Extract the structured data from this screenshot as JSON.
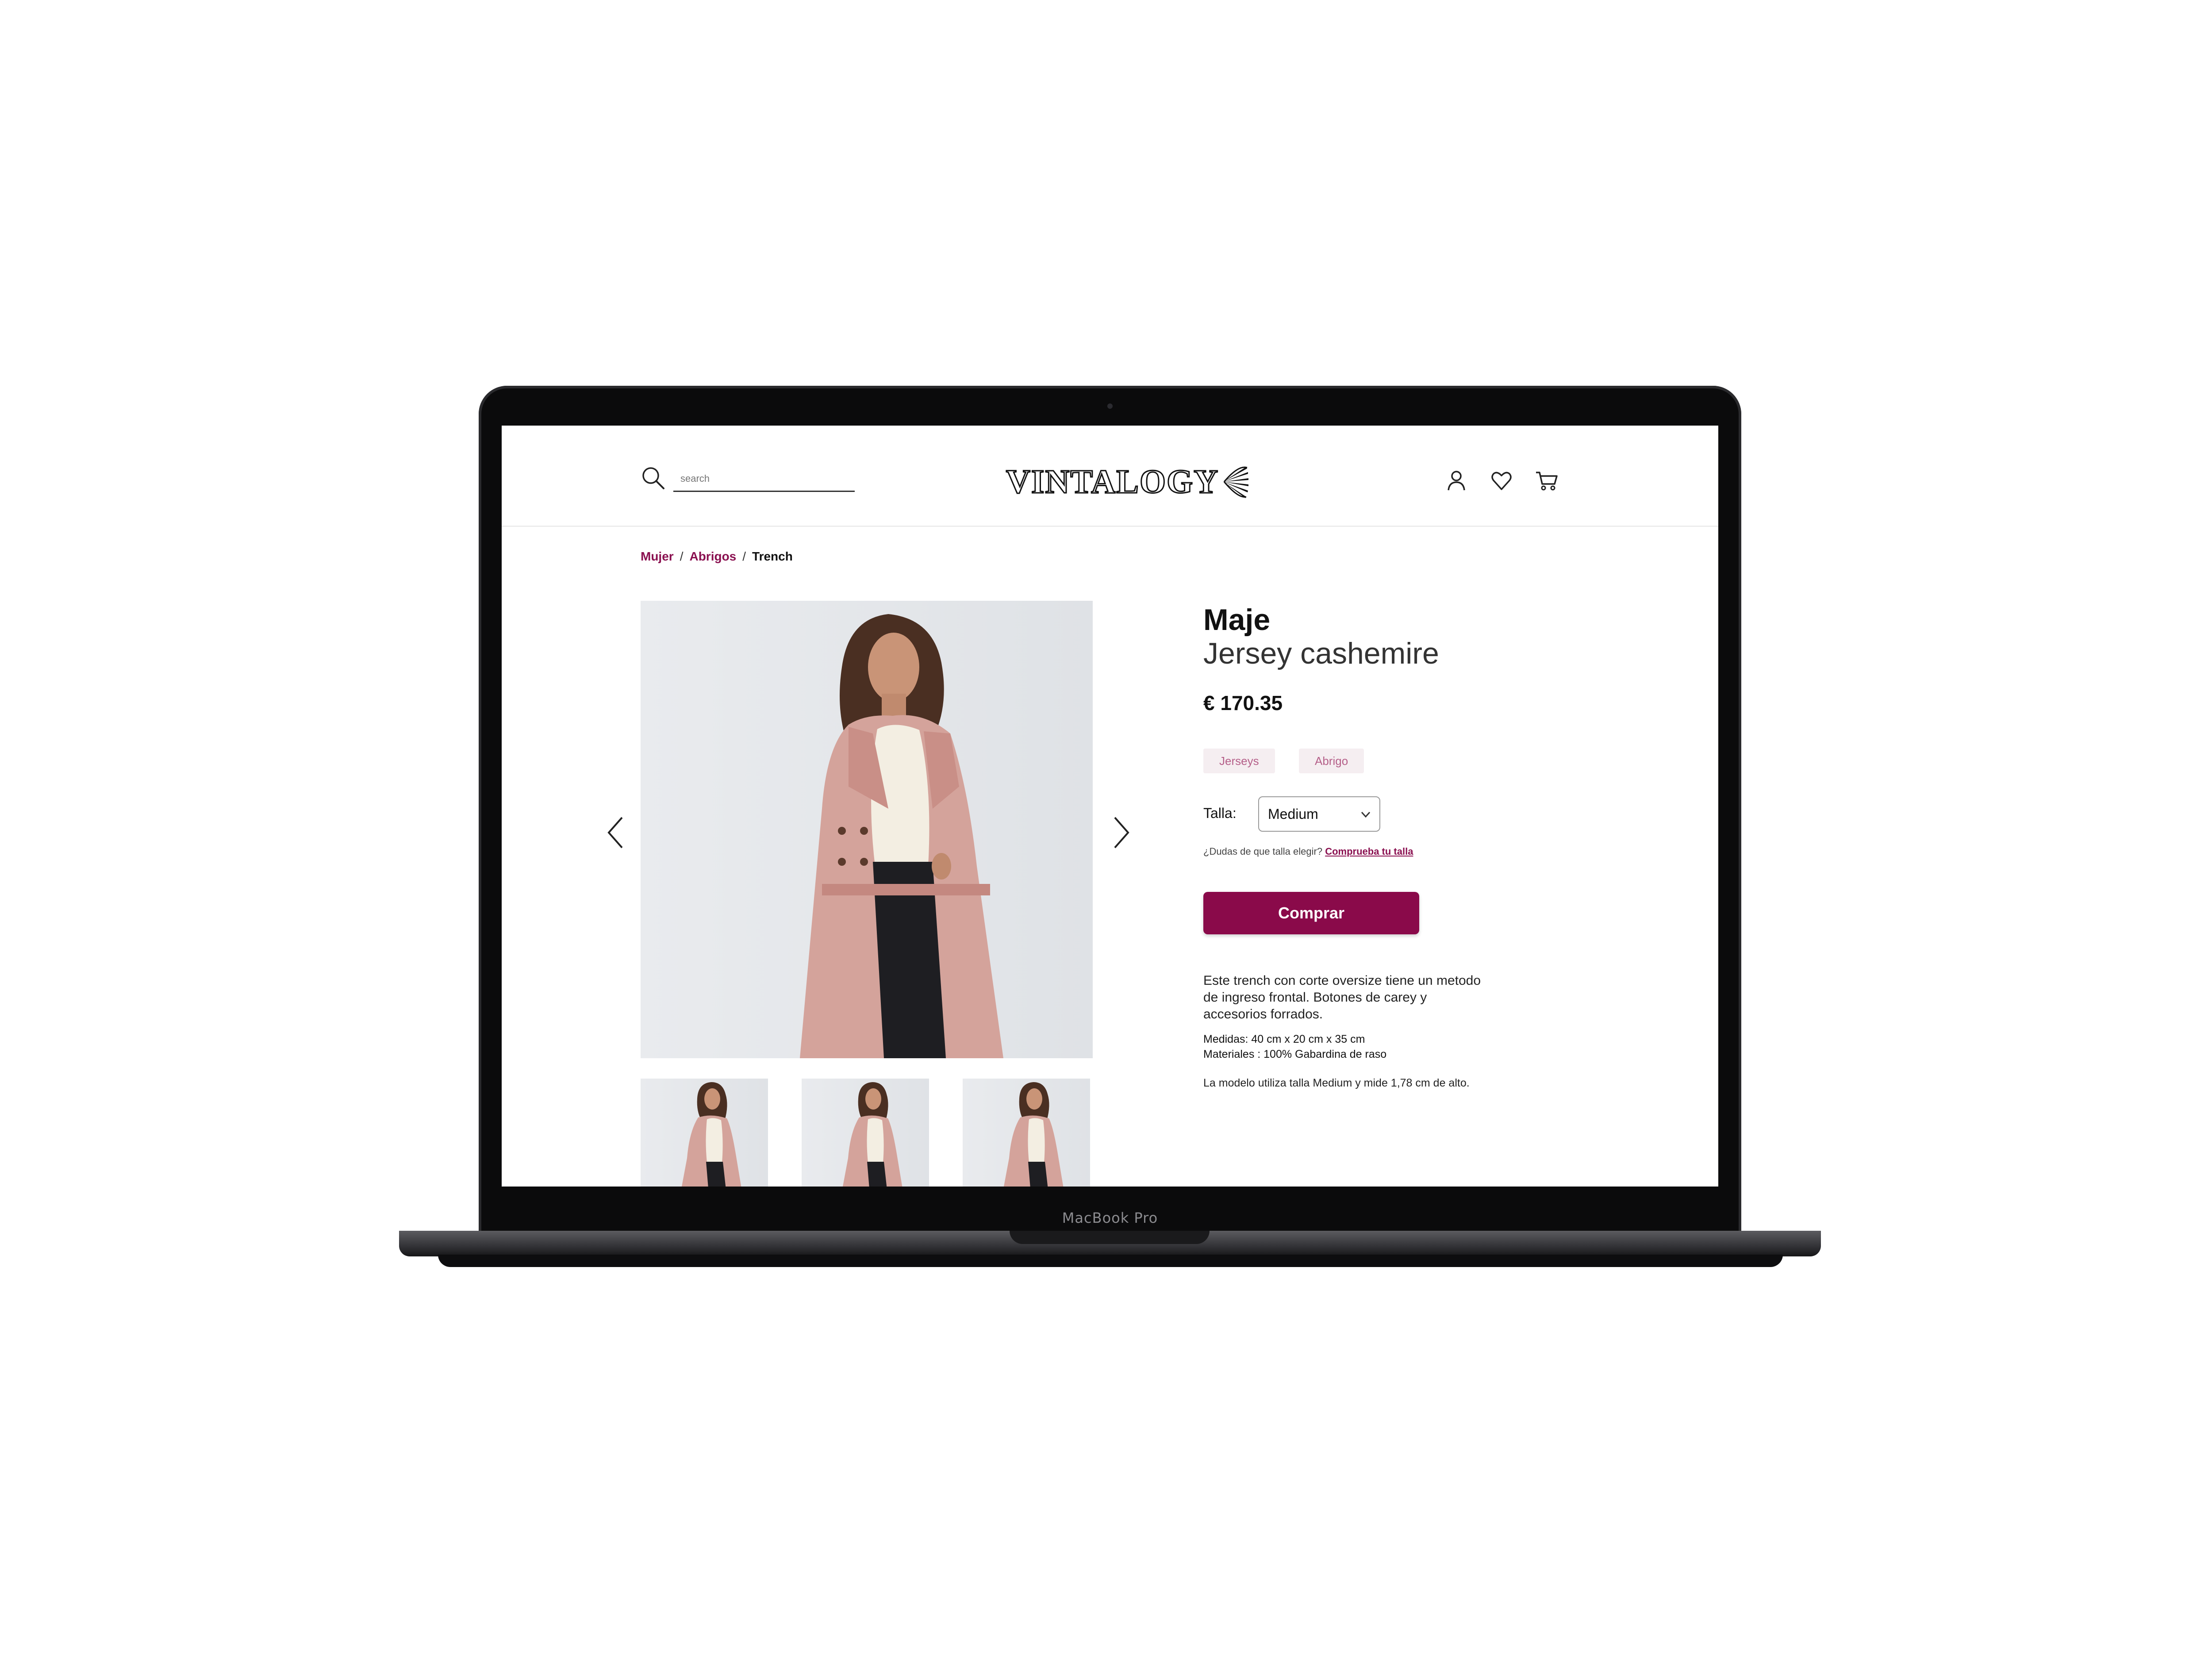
{
  "device": {
    "label": "MacBook Pro"
  },
  "header": {
    "search_placeholder": "search",
    "logo_text": "VINTALOGY"
  },
  "breadcrumb": [
    "Mujer",
    "Abrigos",
    "Trench"
  ],
  "product": {
    "brand": "Maje",
    "name": "Jersey cashemire",
    "price": "€ 170.35",
    "tags": [
      "Jerseys",
      "Abrigo"
    ],
    "size_label": "Talla:",
    "size_selected": "Medium",
    "size_help": "¿Dudas de que talla elegir?",
    "size_help_link": "Comprueba tu talla",
    "buy_label": "Comprar",
    "description": "Este trench con corte oversize tiene un metodo de ingreso frontal. Botones de carey y accesorios forrados.",
    "measures": "Medidas: 40 cm x 20 cm x 35 cm",
    "materials": "Materiales : 100% Gabardina de raso",
    "model_note": "La modelo utiliza talla Medium y mide 1,78 cm de alto."
  },
  "colors": {
    "accent": "#8a0a4a",
    "tag_bg": "#f5eef1",
    "tag_text": "#b55f89",
    "coat": "#d4a39b"
  },
  "icons": [
    "search-icon",
    "user-icon",
    "heart-icon",
    "cart-icon",
    "chevron-left-icon",
    "chevron-right-icon",
    "chevron-down-icon"
  ]
}
